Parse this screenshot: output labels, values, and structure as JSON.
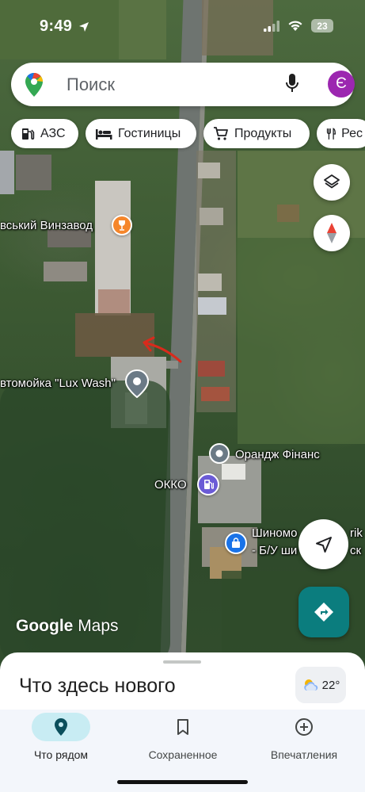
{
  "status_bar": {
    "time": "9:49",
    "battery": "23"
  },
  "search": {
    "placeholder": "Поиск",
    "avatar_letter": "Є"
  },
  "chips": [
    {
      "label": "АЗС",
      "icon": "gas-station-icon"
    },
    {
      "label": "Гостиницы",
      "icon": "bed-icon"
    },
    {
      "label": "Продукты",
      "icon": "cart-icon"
    },
    {
      "label": "Рес",
      "icon": "restaurant-icon"
    }
  ],
  "map_labels": {
    "winery": "вський Винзавод",
    "car_wash": "втомойка \"Lux Wash\"",
    "finance": "Орандж Фінанс",
    "gas_station": "ОККО",
    "tire_line1": "Шиномо",
    "tire_line1_end": "rik",
    "tire_line2": "- Б/У ши",
    "tire_line2_end": "ск"
  },
  "google_logo": {
    "brand": "Google",
    "product": "Maps"
  },
  "sheet": {
    "title": "Что здесь нового"
  },
  "weather": {
    "temperature": "22°",
    "icon": "partly-cloudy-icon"
  },
  "bottom_nav": [
    {
      "label": "Что рядом",
      "icon": "location-pin-icon",
      "active": true
    },
    {
      "label": "Сохраненное",
      "icon": "bookmark-icon",
      "active": false
    },
    {
      "label": "Впечатления",
      "icon": "add-circle-icon",
      "active": false
    }
  ],
  "colors": {
    "accent_teal": "#0b7d7e",
    "avatar_purple": "#9c27b0",
    "winery_orange": "#f5862b",
    "poi_gray": "#6b7a86",
    "fuel_purple": "#6b5bd6",
    "shop_blue": "#1a73e8",
    "annotation_red": "#d92a1c"
  }
}
